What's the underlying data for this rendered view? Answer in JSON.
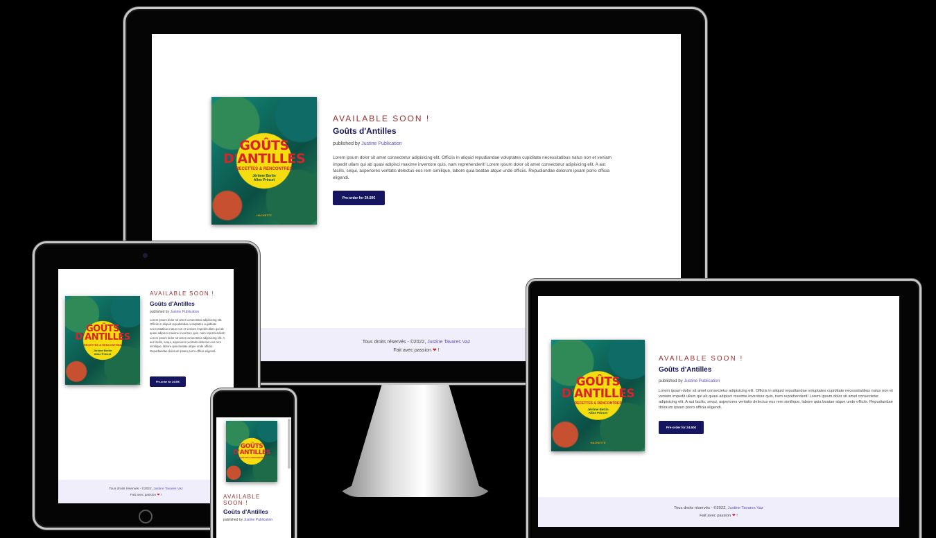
{
  "site": {
    "availability": "AVAILABLE SOON !",
    "book_title": "Goûts d'Antilles",
    "published_prefix": "published by",
    "publisher": "Justine Publication",
    "description": "Lorem ipsum dolor sit amet consectetur adipisicing elit. Officiis in aliquid repudiandae voluptates cupiditate necessitatibus natus non et veniam impedit ullam qui ab quasi adipisci maxime inventore quis, nam reprehenderit! Lorem ipsum dolor sit amet consectetur adipisicing elit. A aut facilis, sequi, asperiores veritatis delectus eos rem similique, labore quia beatae atque unde officiis. Repudiandae dolorum ipsam porro officia eligendi.",
    "preorder_label": "Pre-order for 24.50€",
    "preorder_label_small": "Pre-order for 24.50€",
    "footer_rights": "Tous droits réservés - ©2022,",
    "footer_author": "Justine Tavares Vaz",
    "footer_made": "Fait avec passion",
    "footer_heart": "❤",
    "footer_end": "!"
  },
  "cover": {
    "title_line1": "GOÛTS",
    "title_line2": "D'ANTILLES",
    "subtitle": "RECETTES & RENCONTRES",
    "author1": "Jérôme Bertin",
    "author2": "Aline Princet",
    "publisher_mark": "HACHETTE"
  },
  "colors": {
    "accent_navy": "#161660",
    "availability_red": "#9b2c2c",
    "link_purple": "#5a4fb8",
    "footer_bg": "#f1eefb"
  }
}
